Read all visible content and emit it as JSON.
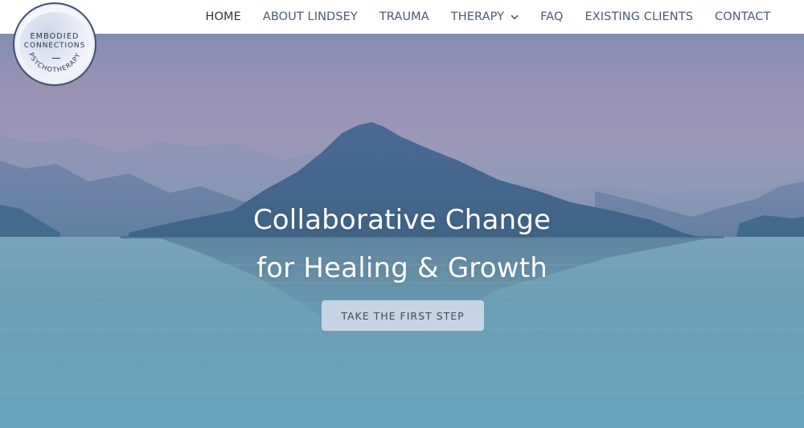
{
  "logo": {
    "line1": "EMBODIED",
    "line2": "CONNECTIONS",
    "arc_text": "PSYCHOTHERAPY"
  },
  "nav": {
    "items": [
      {
        "label": "HOME",
        "active": true
      },
      {
        "label": "ABOUT LINDSEY"
      },
      {
        "label": "TRAUMA"
      },
      {
        "label": "THERAPY",
        "has_dropdown": true
      },
      {
        "label": "FAQ"
      },
      {
        "label": "EXISTING CLIENTS"
      },
      {
        "label": "CONTACT"
      }
    ]
  },
  "hero": {
    "headline_line1": "Collaborative Change",
    "headline_line2": "for Healing & Growth",
    "cta_label": "TAKE THE FIRST STEP"
  },
  "colors": {
    "nav_text": "#4a5b74",
    "nav_active": "#2f3440",
    "cta_bg": "#d4dbea",
    "cta_text": "#3e4a5e"
  }
}
